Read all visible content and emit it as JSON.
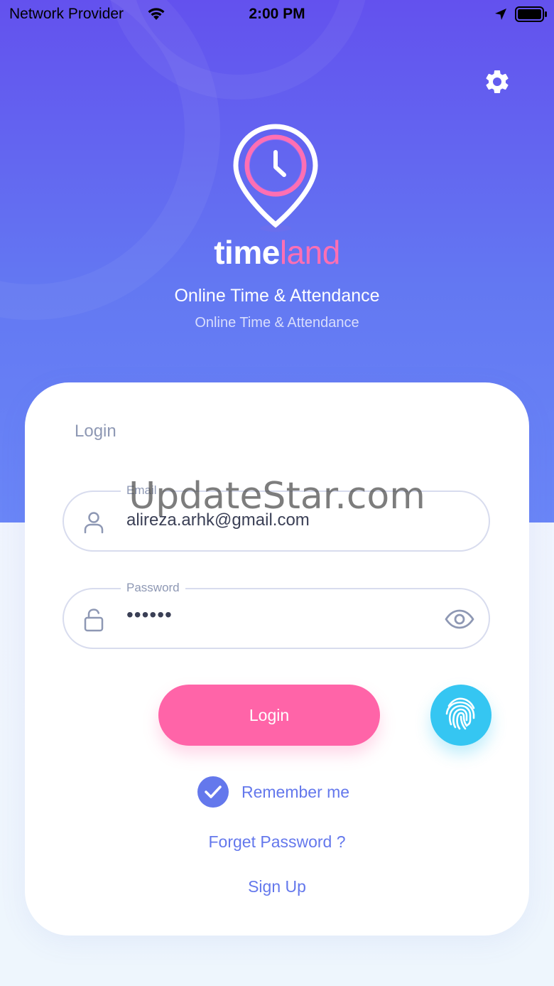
{
  "status_bar": {
    "carrier": "Network Provider",
    "time": "2:00 PM"
  },
  "brand": {
    "name_part1": "time",
    "name_part2": "land",
    "tagline": "Online Time & Attendance",
    "subtagline": "Online Time & Attendance"
  },
  "login_card": {
    "title": "Login",
    "email": {
      "label": "Email",
      "value": "alireza.arhk@gmail.com"
    },
    "password": {
      "label": "Password",
      "value": "••••••"
    },
    "login_button": "Login",
    "remember_me": "Remember me",
    "remember_checked": true,
    "forgot_password": "Forget Password ?",
    "sign_up": "Sign Up"
  },
  "watermark": "UpdateStar.com",
  "colors": {
    "hero_top": "#6351ee",
    "hero_bottom": "#6a86f7",
    "accent_pink": "#ff64a8",
    "accent_blue": "#6478ec",
    "fingerprint": "#35c6f2"
  },
  "icons": [
    "wifi-icon",
    "location-arrow-icon",
    "battery-icon",
    "gear-icon",
    "clock-pin-logo",
    "user-icon",
    "unlock-icon",
    "eye-icon",
    "fingerprint-icon",
    "check-icon"
  ]
}
